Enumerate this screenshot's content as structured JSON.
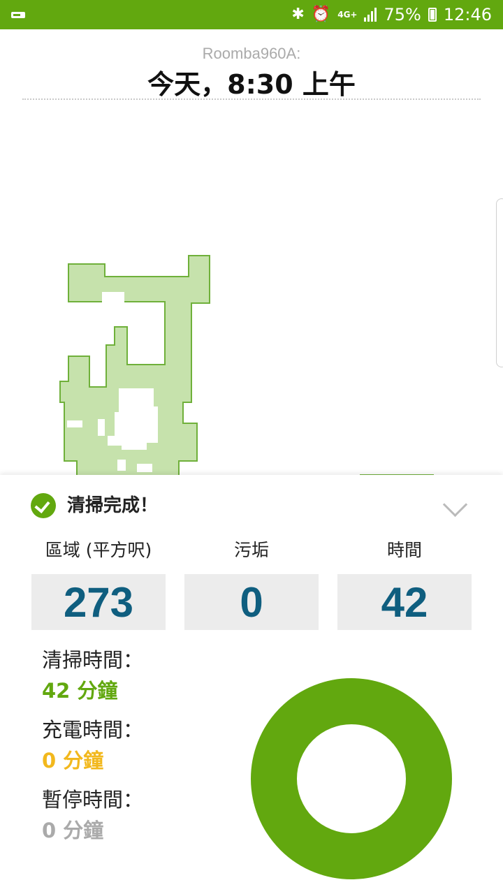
{
  "status_bar": {
    "network": "4G+",
    "battery": "75%",
    "time": "12:46",
    "bg_color": "#62a80f"
  },
  "header": {
    "robot_name": "Roomba960A:",
    "mission_date": "今天，8:30 上午"
  },
  "summary": {
    "title": "清掃完成！",
    "stats": [
      {
        "label": "區域 (平方呎)",
        "value": "273"
      },
      {
        "label": "污垢",
        "value": "0"
      },
      {
        "label": "時間",
        "value": "42"
      }
    ],
    "times": [
      {
        "label": "清掃時間：",
        "value": "42 分鐘",
        "color": "#62a80f"
      },
      {
        "label": "充電時間：",
        "value": "0 分鐘",
        "color": "#f2b81d"
      },
      {
        "label": "暫停時間：",
        "value": "0 分鐘",
        "color": "#aaaaaa"
      }
    ]
  },
  "colors": {
    "accent": "#62a80f",
    "map_fill": "#c6e2ac",
    "value_blue": "#0f5e7f"
  }
}
